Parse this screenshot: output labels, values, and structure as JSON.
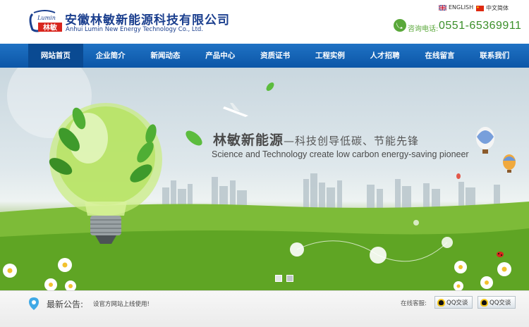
{
  "header": {
    "logo_text": "林敏",
    "logo_script": "Lumin",
    "company_cn": "安徽林敏新能源科技有限公司",
    "company_en": "Anhui Lumin New Energy Technology Co., Ltd.",
    "lang_en": "ENGLISH",
    "lang_cn": "中文简体",
    "phone_label": "咨询电话:",
    "phone_number": "0551-65369911"
  },
  "nav": {
    "items": [
      "网站首页",
      "企业简介",
      "新闻动态",
      "产品中心",
      "资质证书",
      "工程实例",
      "人才招聘",
      "在线留言",
      "联系我们"
    ],
    "active_index": 0
  },
  "banner": {
    "slogan_cn_main": "林敏新能源",
    "slogan_cn_sub": "—科技创导低碳、节能先锋",
    "slogan_en": "Science and Technology create low carbon energy-saving pioneer",
    "slide_count": 2,
    "active_slide": 1
  },
  "notice": {
    "title": "最新公告:",
    "text": "设官方网站上线使用!",
    "cs_label": "在线客服:",
    "qq_buttons": [
      "QQ交谈",
      "QQ交谈"
    ]
  },
  "colors": {
    "brand_blue": "#1b3f8e",
    "nav_blue": "#0c56a7",
    "phone_green": "#3b8f2a"
  }
}
